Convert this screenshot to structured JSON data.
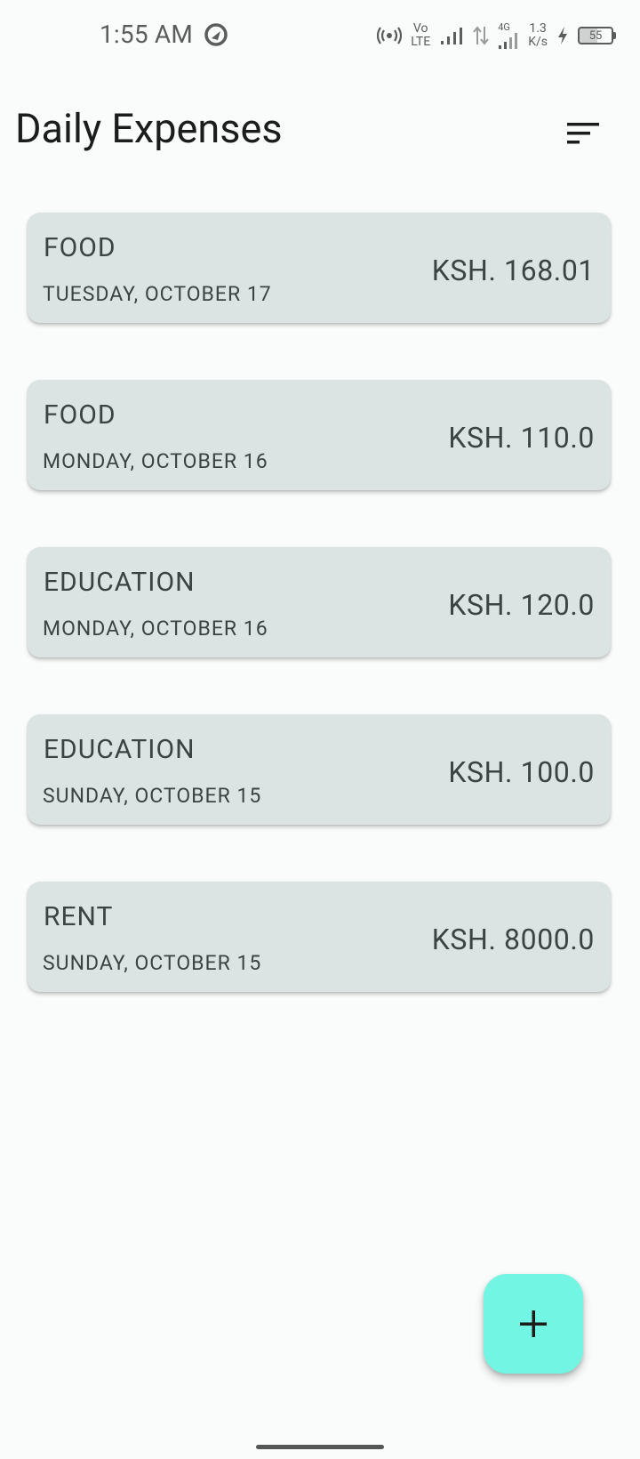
{
  "status_bar": {
    "time": "1:55 AM",
    "network_label_top": "Vo",
    "network_label_bottom": "LTE",
    "network_type": "4G",
    "speed_value": "1.3",
    "speed_unit": "K/s",
    "battery_level": "55",
    "icons": [
      "location-icon",
      "hotspot-icon",
      "signal-icon",
      "signal-icon",
      "data-arrows-icon",
      "charging-icon",
      "battery-icon"
    ]
  },
  "app_bar": {
    "title": "Daily Expenses",
    "sort_icon": "sort-icon"
  },
  "expenses": [
    {
      "category": "FOOD",
      "date": "TUESDAY, OCTOBER 17",
      "amount": "KSH. 168.01"
    },
    {
      "category": "FOOD",
      "date": "MONDAY, OCTOBER 16",
      "amount": "KSH. 110.0"
    },
    {
      "category": "EDUCATION",
      "date": "MONDAY, OCTOBER 16",
      "amount": "KSH. 120.0"
    },
    {
      "category": "EDUCATION",
      "date": "SUNDAY, OCTOBER 15",
      "amount": "KSH. 100.0"
    },
    {
      "category": "RENT",
      "date": "SUNDAY, OCTOBER 15",
      "amount": "KSH. 8000.0"
    }
  ],
  "fab": {
    "icon": "plus-icon"
  },
  "colors": {
    "background": "#fafcfb",
    "card": "#dbe4e2",
    "card_text": "#3b4443",
    "fab": "#73f5e3",
    "title": "#1b1c1c"
  }
}
